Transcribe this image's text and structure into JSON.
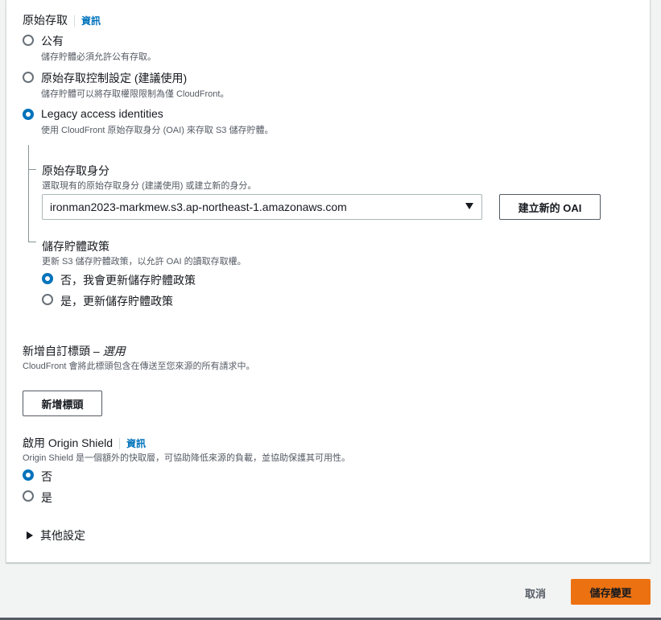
{
  "origin_access": {
    "title": "原始存取",
    "info": "資訊",
    "options": [
      {
        "label": "公有",
        "desc": "儲存貯體必須允許公有存取。",
        "checked": false
      },
      {
        "label": "原始存取控制設定 (建議使用)",
        "desc": "儲存貯體可以將存取權限限制為僅 CloudFront。",
        "checked": false
      },
      {
        "label": "Legacy access identities",
        "desc": "使用 CloudFront 原始存取身分 (OAI) 來存取 S3 儲存貯體。",
        "checked": true
      }
    ]
  },
  "oai": {
    "title": "原始存取身分",
    "desc": "選取現有的原始存取身分 (建議使用) 或建立新的身分。",
    "selected": "ironman2023-markmew.s3.ap-northeast-1.amazonaws.com",
    "create_button": "建立新的 OAI"
  },
  "bucket_policy": {
    "title": "儲存貯體政策",
    "desc": "更新 S3 儲存貯體政策，以允許 OAI 的讀取存取權。",
    "options": [
      {
        "label": "否，我會更新儲存貯體政策",
        "checked": true
      },
      {
        "label": "是，更新儲存貯體政策",
        "checked": false
      }
    ]
  },
  "custom_headers": {
    "title": "新增自訂標頭 –",
    "optional": "選用",
    "desc": "CloudFront 會將此標頭包含在傳送至您來源的所有請求中。",
    "button": "新增標頭"
  },
  "origin_shield": {
    "title": "啟用 Origin Shield",
    "info": "資訊",
    "desc": "Origin Shield 是一個額外的快取層，可協助降低來源的負載，並協助保護其可用性。",
    "options": [
      {
        "label": "否",
        "checked": true
      },
      {
        "label": "是",
        "checked": false
      }
    ]
  },
  "other_settings": {
    "label": "其他設定"
  },
  "footer": {
    "cancel": "取消",
    "save": "儲存變更"
  },
  "colors": {
    "accent": "#0073bb",
    "primary_button": "#ec7211"
  }
}
